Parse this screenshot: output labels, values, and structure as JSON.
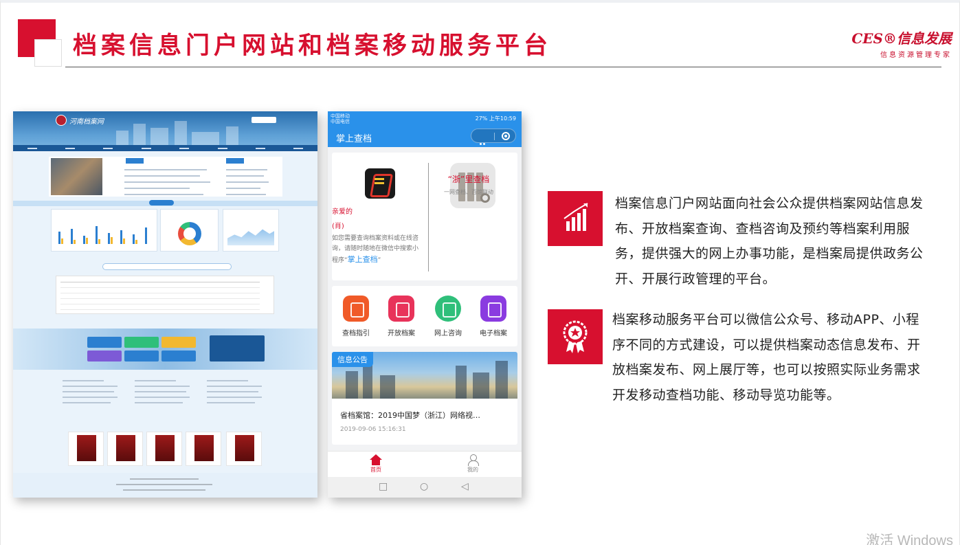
{
  "header": {
    "title": "档案信息门户网站和档案移动服务平台",
    "logo_main": "CES®信息发展",
    "logo_sub": "信息资源管理专家"
  },
  "phone": {
    "status_left_1": "中国移动",
    "status_left_2": "中国电信",
    "status_right": "27% 上午10:59",
    "app_title": "掌上查档",
    "greeting": "亲爱的",
    "greeting_name": "(肖)",
    "desc": "如您需要查询档案资料或在线咨询，请随时随地在微信中搜索小程序“",
    "desc_highlight": "掌上查档",
    "desc_end": "”",
    "brand_title": "“浙”里查档",
    "brand_sub": "一网查档、百馆联动",
    "services": [
      {
        "label": "查档指引",
        "color": "#f05a28"
      },
      {
        "label": "开放档案",
        "color": "#e8335a"
      },
      {
        "label": "网上咨询",
        "color": "#2fbf7a"
      },
      {
        "label": "电子档案",
        "color": "#8a3be0"
      }
    ],
    "news_tag": "信息公告",
    "news_title": "省档案馆：2019中国梦（浙江）网络视…",
    "news_date": "2019-09-06 15:16:31",
    "tab_home": "首页",
    "tab_me": "我的",
    "sysnav": [
      "□",
      "○",
      "◁"
    ]
  },
  "website": {
    "site_name": "河南档案网"
  },
  "paragraphs": {
    "p1": "档案信息门户网站面向社会公众提供档案网站信息发布、开放档案查询、查档咨询及预约等档案利用服务，提供强大的网上办事功能，是档案局提供政务公开、开展行政管理的平台。",
    "p2": "档案移动服务平台可以微信公众号、移动APP、小程序不同的方式建设，可以提供档案动态信息发布、开放档案发布、网上展厅等，也可以按照实际业务需求开发移动查档功能、移动导览功能等。"
  },
  "watermark": "激活 Windows",
  "colors": {
    "accent": "#d7102f",
    "phone_blue": "#2a91ea"
  }
}
